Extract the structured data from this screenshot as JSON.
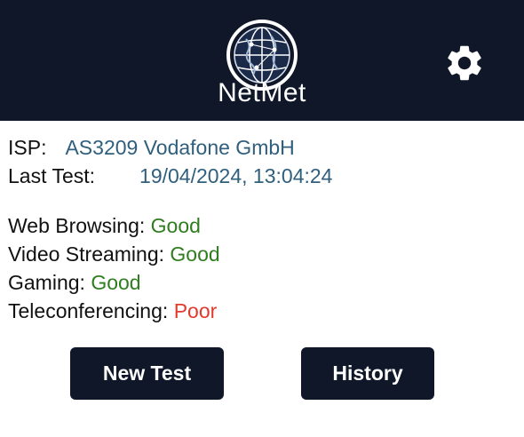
{
  "header": {
    "app_name": "NetMet",
    "logo_icon": "globe-icon",
    "settings_icon": "gear-icon",
    "background_color": "#0f1729"
  },
  "info": {
    "isp_label": "ISP:",
    "isp_value": "AS3209 Vodafone GmbH",
    "last_test_label": "Last Test:",
    "last_test_value": "19/04/2024, 13:04:24"
  },
  "ratings": [
    {
      "label": "Web Browsing:",
      "value": "Good"
    },
    {
      "label": "Video Streaming:",
      "value": "Good"
    },
    {
      "label": "Gaming:",
      "value": "Good"
    },
    {
      "label": "Teleconferencing:",
      "value": "Poor"
    }
  ],
  "buttons": {
    "new_test": "New Test",
    "history": "History"
  },
  "colors": {
    "good": "#2f7d1f",
    "poor": "#e03a2c",
    "info_value": "#2f5f7d"
  }
}
